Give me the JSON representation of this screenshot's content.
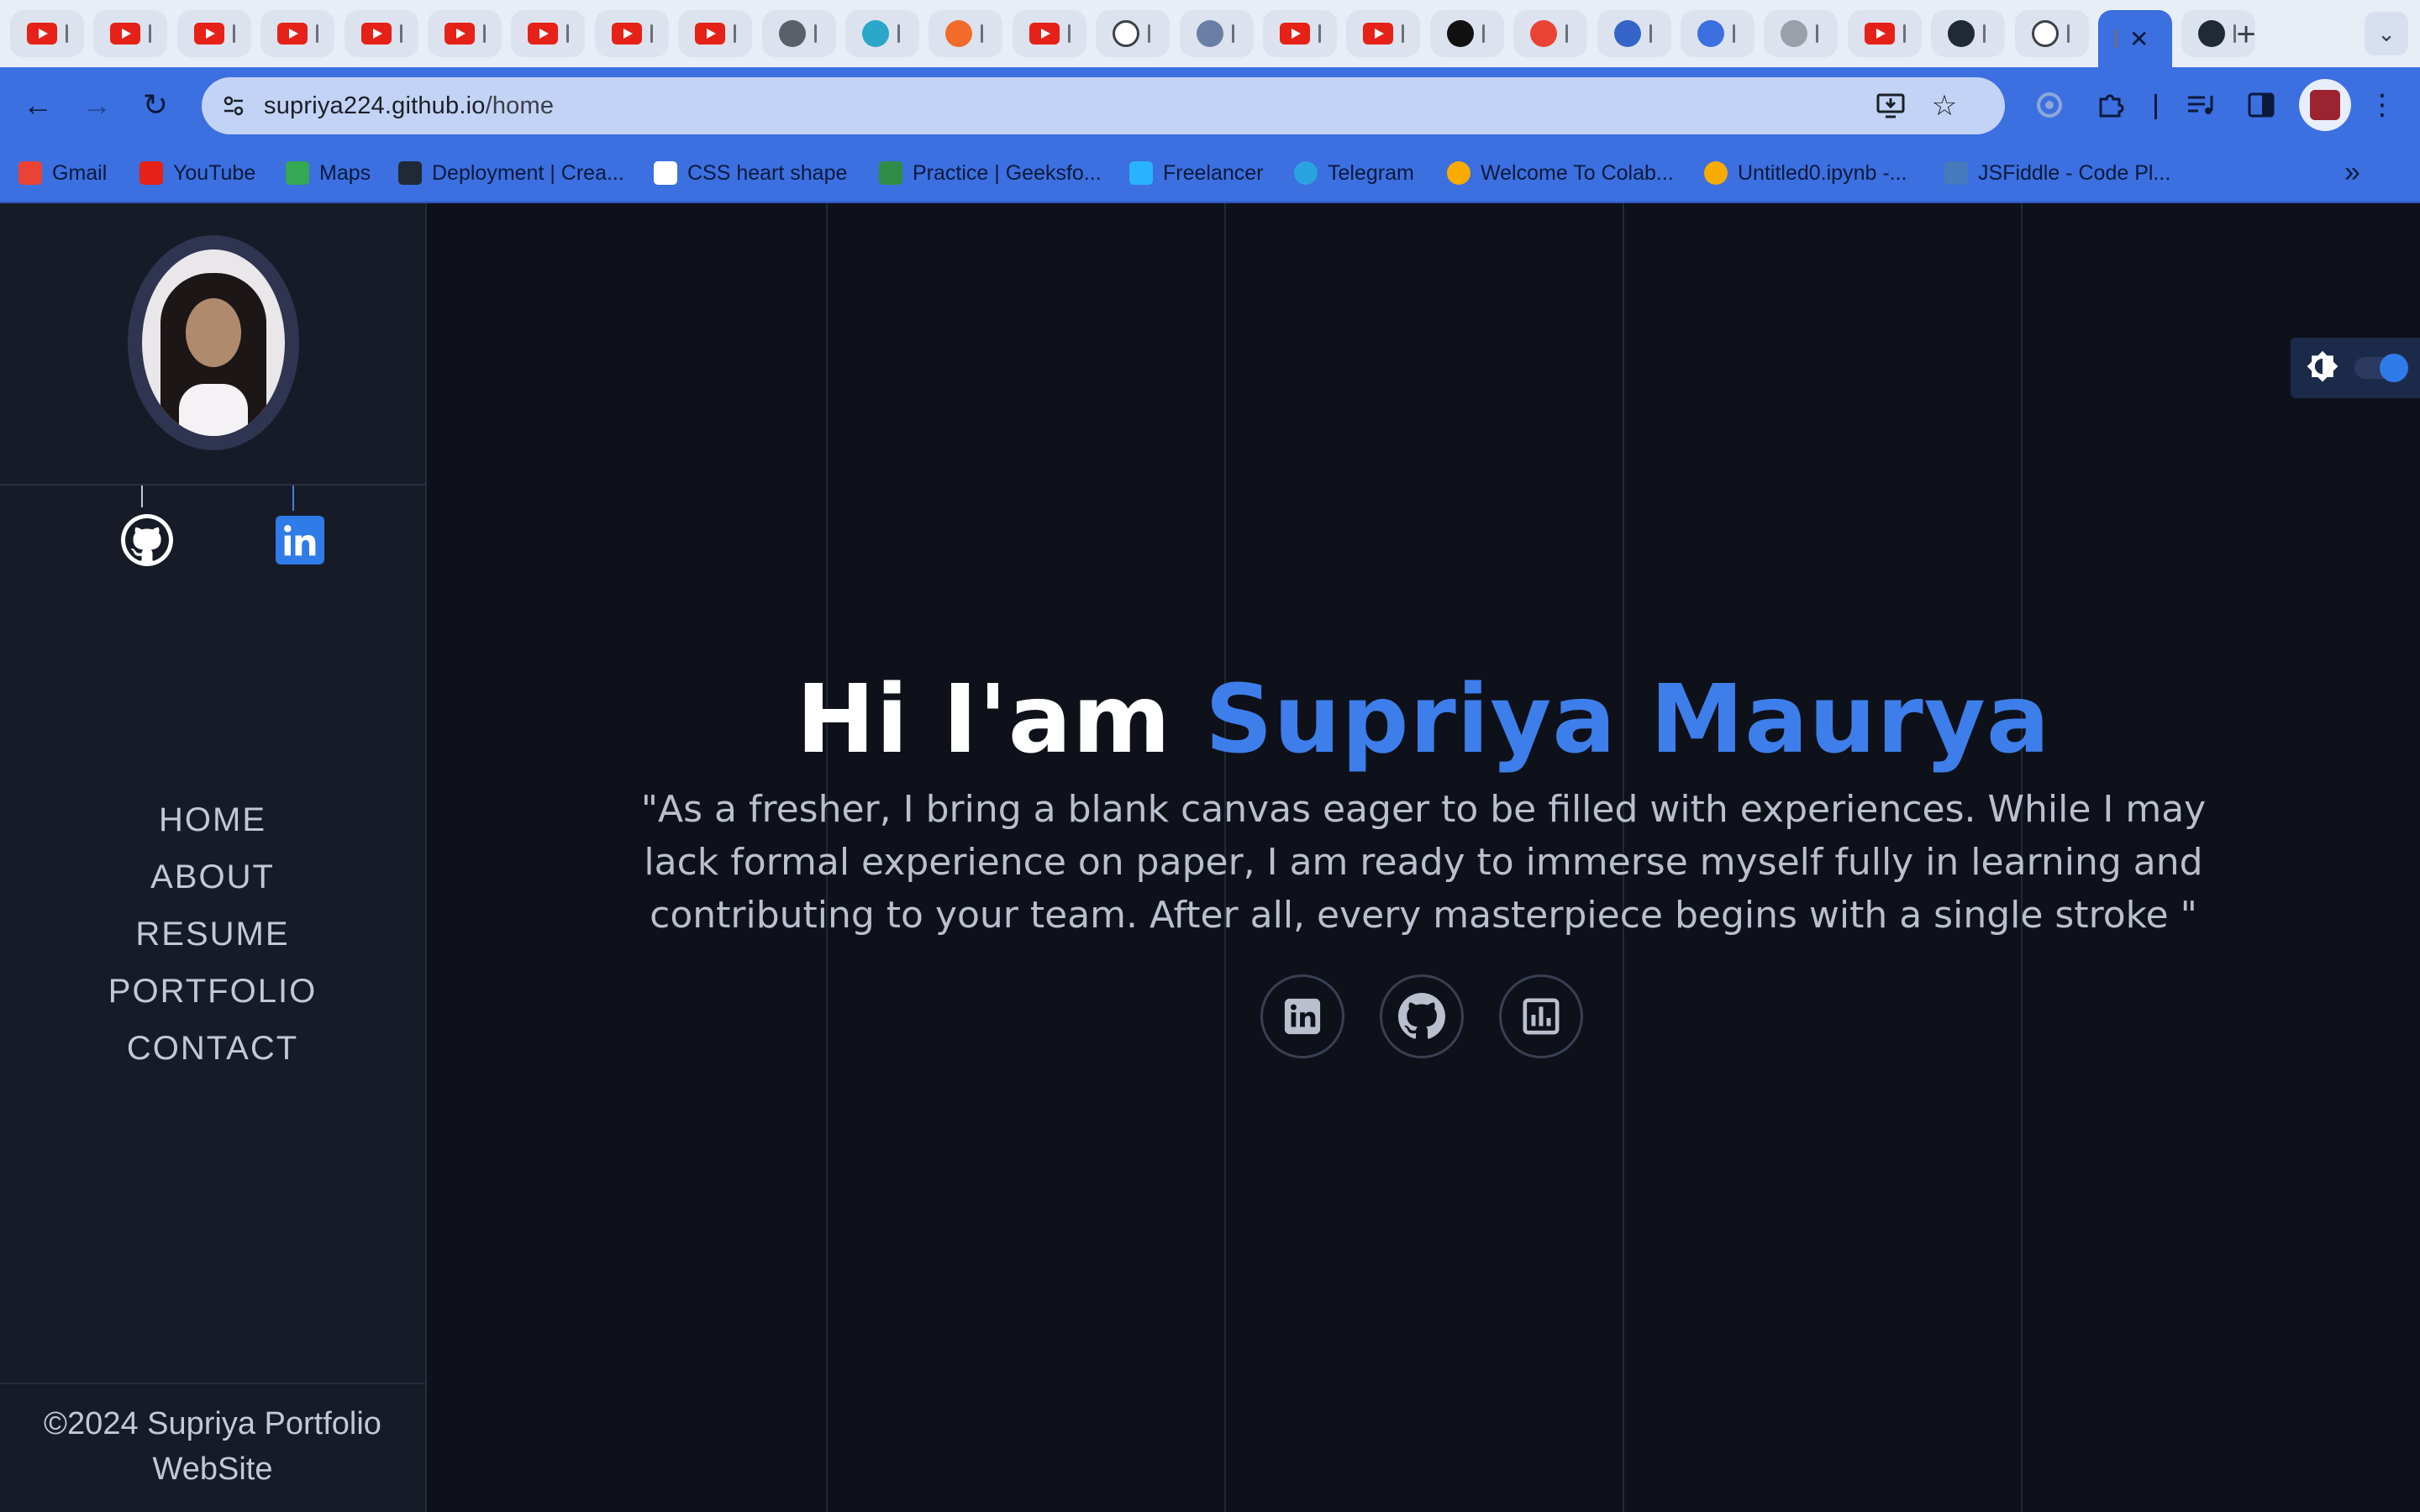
{
  "browser": {
    "tabs": [
      {
        "icon": "youtube-icon"
      },
      {
        "icon": "youtube-icon"
      },
      {
        "icon": "youtube-icon"
      },
      {
        "icon": "youtube-icon"
      },
      {
        "icon": "youtube-icon"
      },
      {
        "icon": "youtube-icon"
      },
      {
        "icon": "youtube-icon"
      },
      {
        "icon": "youtube-icon"
      },
      {
        "icon": "youtube-icon"
      },
      {
        "icon": "speaker-icon"
      },
      {
        "icon": "n-app-icon"
      },
      {
        "icon": "orange-app-icon"
      },
      {
        "icon": "youtube-icon"
      },
      {
        "icon": "github-icon"
      },
      {
        "icon": "app-icon"
      },
      {
        "icon": "youtube-icon"
      },
      {
        "icon": "youtube-icon"
      },
      {
        "icon": "notion-icon"
      },
      {
        "icon": "gmail-icon"
      },
      {
        "icon": "k-app-icon"
      },
      {
        "icon": "a-app-icon"
      },
      {
        "icon": "globe-icon"
      },
      {
        "icon": "youtube-icon"
      },
      {
        "icon": "react-icon"
      },
      {
        "icon": "github-icon"
      },
      {
        "icon": "active-tab"
      },
      {
        "icon": "react-icon"
      }
    ],
    "new_tab_label": "+",
    "url_host": "supriya224.github.io",
    "url_path": "/home",
    "accent_color": "#3c6fe0",
    "bookmarks": [
      {
        "label": "Gmail",
        "icon": "gmail-icon"
      },
      {
        "label": "YouTube",
        "icon": "youtube-icon"
      },
      {
        "label": "Maps",
        "icon": "maps-icon"
      },
      {
        "label": "Deployment | Crea...",
        "icon": "react-icon"
      },
      {
        "label": "CSS heart shape",
        "icon": "codepen-icon"
      },
      {
        "label": "Practice | Geeksfo...",
        "icon": "gfg-icon"
      },
      {
        "label": "Freelancer",
        "icon": "freelancer-icon"
      },
      {
        "label": "Telegram",
        "icon": "telegram-icon"
      },
      {
        "label": "Welcome To Colab...",
        "icon": "colab-icon"
      },
      {
        "label": "Untitled0.ipynb -...",
        "icon": "colab-icon"
      },
      {
        "label": "JSFiddle - Code Pl...",
        "icon": "jsfiddle-icon"
      }
    ]
  },
  "sidebar": {
    "nav": [
      "HOME",
      "ABOUT",
      "RESUME",
      "PORTFOLIO",
      "CONTACT"
    ],
    "footer": [
      "©2024 Supriya Portfolio",
      "WebSite"
    ]
  },
  "hero": {
    "greeting": "Hi I'am ",
    "name": "Supriya Maurya",
    "quote": "\"As a fresher, I bring a blank canvas eager to be filled with experiences. While I may lack formal experience on paper, I am ready to immerse myself fully in learning and contributing to your team. After all, every masterpiece begins with a single stroke \"",
    "name_color": "#3e7eea"
  }
}
